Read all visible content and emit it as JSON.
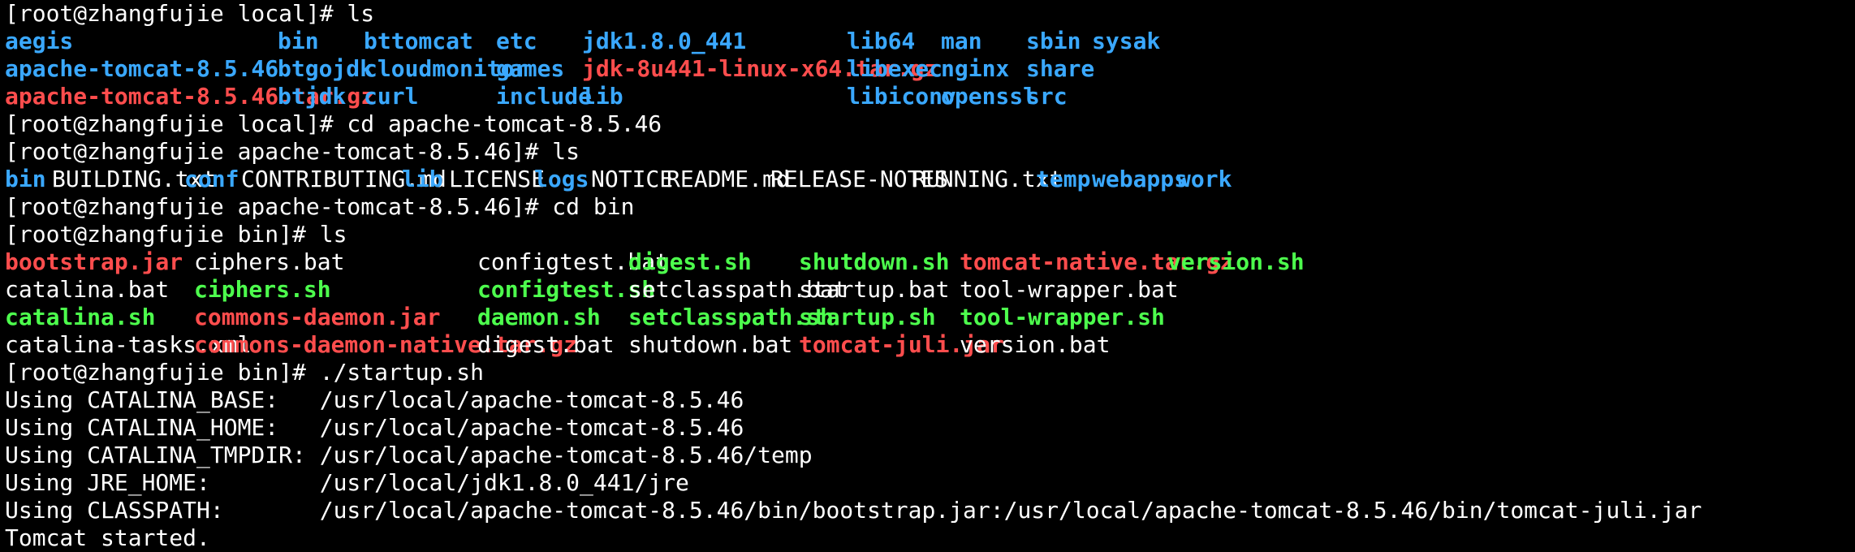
{
  "theme": {
    "background": "#000000",
    "foreground": "#ffffff",
    "dir_color": "#3aa8ff",
    "archive_color": "#ff4d4d",
    "exec_color": "#4dff4d"
  },
  "lines": [
    {
      "kind": "prompt",
      "text": "[root@zhangfujie local]# ls"
    },
    {
      "kind": "listing",
      "items": [
        {
          "name": "aegis",
          "type": "dir"
        },
        {
          "name": "bin",
          "type": "dir"
        },
        {
          "name": "bttomcat",
          "type": "dir"
        },
        {
          "name": "etc",
          "type": "dir"
        },
        {
          "name": "jdk1.8.0_441",
          "type": "dir"
        },
        {
          "name": "lib64",
          "type": "dir"
        },
        {
          "name": "man",
          "type": "dir"
        },
        {
          "name": "sbin",
          "type": "dir"
        },
        {
          "name": "sysak",
          "type": "dir"
        }
      ]
    },
    {
      "kind": "listing",
      "items": [
        {
          "name": "apache-tomcat-8.5.46",
          "type": "dir"
        },
        {
          "name": "btgojdk",
          "type": "dir"
        },
        {
          "name": "cloudmonitor",
          "type": "dir"
        },
        {
          "name": "games",
          "type": "dir"
        },
        {
          "name": "jdk-8u441-linux-x64.tar.gz",
          "type": "archive"
        },
        {
          "name": "libexec",
          "type": "dir"
        },
        {
          "name": "nginx",
          "type": "dir"
        },
        {
          "name": "share",
          "type": "dir"
        }
      ]
    },
    {
      "kind": "listing",
      "items": [
        {
          "name": "apache-tomcat-8.5.46.tar.gz",
          "type": "archive"
        },
        {
          "name": "btjdk",
          "type": "dir"
        },
        {
          "name": "curl",
          "type": "dir"
        },
        {
          "name": "include",
          "type": "dir"
        },
        {
          "name": "lib",
          "type": "dir"
        },
        {
          "name": "libiconv",
          "type": "dir"
        },
        {
          "name": "openssl",
          "type": "dir"
        },
        {
          "name": "src",
          "type": "dir"
        }
      ]
    },
    {
      "kind": "prompt",
      "text": "[root@zhangfujie local]# cd apache-tomcat-8.5.46"
    },
    {
      "kind": "prompt",
      "text": "[root@zhangfujie apache-tomcat-8.5.46]# ls"
    },
    {
      "kind": "listing",
      "items": [
        {
          "name": "bin",
          "type": "dir"
        },
        {
          "name": "BUILDING.txt",
          "type": "text"
        },
        {
          "name": "conf",
          "type": "dir"
        },
        {
          "name": "CONTRIBUTING.md",
          "type": "text"
        },
        {
          "name": "lib",
          "type": "dir"
        },
        {
          "name": "LICENSE",
          "type": "text"
        },
        {
          "name": "logs",
          "type": "dir"
        },
        {
          "name": "NOTICE",
          "type": "text"
        },
        {
          "name": "README.md",
          "type": "text"
        },
        {
          "name": "RELEASE-NOTES",
          "type": "text"
        },
        {
          "name": "RUNNING.txt",
          "type": "text"
        },
        {
          "name": "temp",
          "type": "dir"
        },
        {
          "name": "webapps",
          "type": "dir"
        },
        {
          "name": "work",
          "type": "dir"
        }
      ]
    },
    {
      "kind": "prompt",
      "text": "[root@zhangfujie apache-tomcat-8.5.46]# cd bin"
    },
    {
      "kind": "prompt",
      "text": "[root@zhangfujie bin]# ls"
    },
    {
      "kind": "listing",
      "items": [
        {
          "name": "bootstrap.jar",
          "type": "archive"
        },
        {
          "name": "ciphers.bat",
          "type": "text"
        },
        {
          "name": "configtest.bat",
          "type": "text"
        },
        {
          "name": "digest.sh",
          "type": "exec"
        },
        {
          "name": "shutdown.sh",
          "type": "exec"
        },
        {
          "name": "tomcat-native.tar.gz",
          "type": "archive"
        },
        {
          "name": "version.sh",
          "type": "exec"
        }
      ]
    },
    {
      "kind": "listing",
      "items": [
        {
          "name": "catalina.bat",
          "type": "text"
        },
        {
          "name": "ciphers.sh",
          "type": "exec"
        },
        {
          "name": "configtest.sh",
          "type": "exec"
        },
        {
          "name": "setclasspath.bat",
          "type": "text"
        },
        {
          "name": "startup.bat",
          "type": "text"
        },
        {
          "name": "tool-wrapper.bat",
          "type": "text"
        }
      ]
    },
    {
      "kind": "listing",
      "items": [
        {
          "name": "catalina.sh",
          "type": "exec"
        },
        {
          "name": "commons-daemon.jar",
          "type": "archive"
        },
        {
          "name": "daemon.sh",
          "type": "exec"
        },
        {
          "name": "setclasspath.sh",
          "type": "exec"
        },
        {
          "name": "startup.sh",
          "type": "exec"
        },
        {
          "name": "tool-wrapper.sh",
          "type": "exec"
        }
      ]
    },
    {
      "kind": "listing",
      "items": [
        {
          "name": "catalina-tasks.xml",
          "type": "text"
        },
        {
          "name": "commons-daemon-native.tar.gz",
          "type": "archive"
        },
        {
          "name": "digest.bat",
          "type": "text"
        },
        {
          "name": "shutdown.bat",
          "type": "text"
        },
        {
          "name": "tomcat-juli.jar",
          "type": "archive"
        },
        {
          "name": "version.bat",
          "type": "text"
        }
      ]
    },
    {
      "kind": "prompt",
      "text": "[root@zhangfujie bin]# ./startup.sh"
    },
    {
      "kind": "output",
      "text": "Using CATALINA_BASE:   /usr/local/apache-tomcat-8.5.46"
    },
    {
      "kind": "output",
      "text": "Using CATALINA_HOME:   /usr/local/apache-tomcat-8.5.46"
    },
    {
      "kind": "output",
      "text": "Using CATALINA_TMPDIR: /usr/local/apache-tomcat-8.5.46/temp"
    },
    {
      "kind": "output",
      "text": "Using JRE_HOME:        /usr/local/jdk1.8.0_441/jre"
    },
    {
      "kind": "output",
      "text": "Using CLASSPATH:       /usr/local/apache-tomcat-8.5.46/bin/bootstrap.jar:/usr/local/apache-tomcat-8.5.46/bin/tomcat-juli.jar"
    },
    {
      "kind": "output",
      "text": "Tomcat started."
    }
  ]
}
